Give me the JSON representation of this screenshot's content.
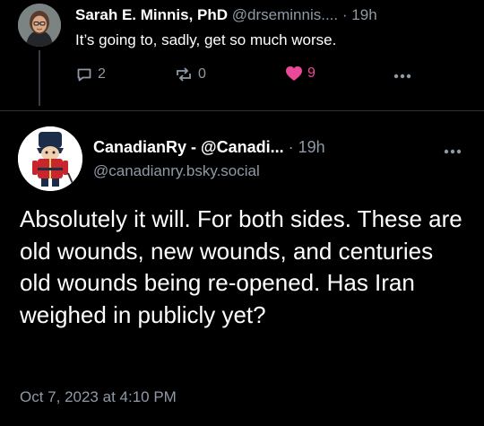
{
  "reply": {
    "author_name": "Sarah E. Minnis, PhD",
    "handle": "@drseminnis....",
    "separator": "·",
    "time": "19h",
    "text": "It’s going to, sadly, get so much worse.",
    "reply_count": "2",
    "repost_count": "0",
    "like_count": "9",
    "icons": [
      "reply-icon",
      "repost-icon",
      "heart-icon",
      "more-icon"
    ]
  },
  "main": {
    "author_name": "CanadianRy - @Canadi...",
    "separator": "·",
    "time": "19h",
    "handle": "@canadianry.bsky.social",
    "text": "Absolutely it will. For both sides. These are old wounds, new wounds, and centuries old wounds being re-opened. Has Iran weighed in publicly yet?",
    "timestamp": "Oct 7, 2023 at 4:10 PM"
  },
  "colors": {
    "background": "#000000",
    "secondary_text": "#8f9aa6",
    "like": "#ec4899",
    "divider": "#2f333a"
  }
}
